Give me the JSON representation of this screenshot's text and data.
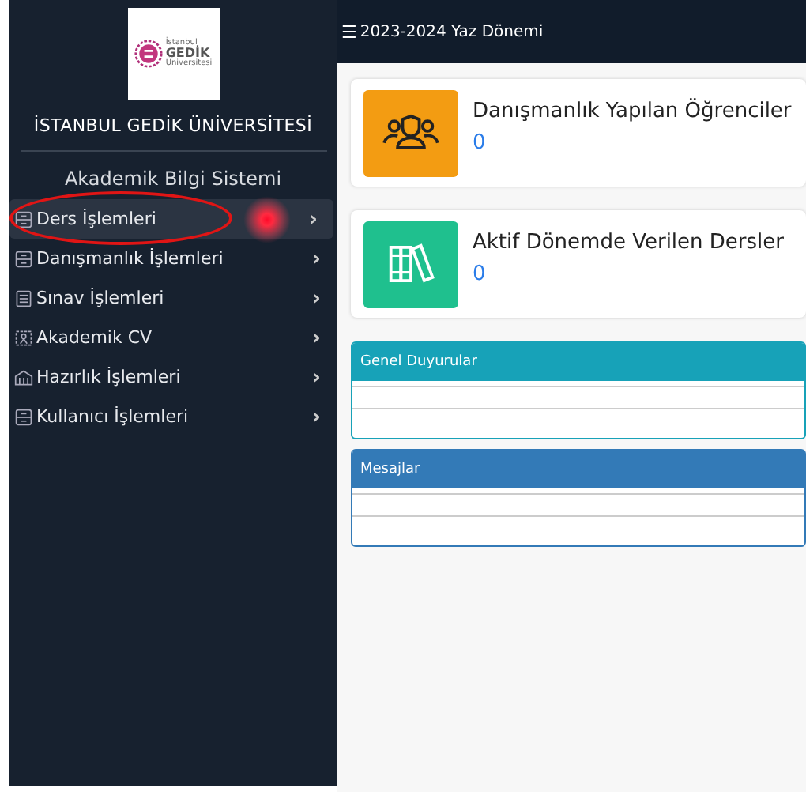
{
  "logo": {
    "small_top": "İstanbul",
    "name": "GEDİK",
    "small_bottom": "Üniversitesi"
  },
  "sidebar": {
    "university": "İSTANBUL GEDİK ÜNİVERSİTESİ",
    "system": "Akademik Bilgi Sistemi",
    "items": [
      {
        "label": "Ders İşlemleri",
        "kind": "form",
        "selected": true
      },
      {
        "label": "Danışmanlık İşlemleri",
        "kind": "form",
        "selected": false
      },
      {
        "label": "Sınav İşlemleri",
        "kind": "list",
        "selected": false
      },
      {
        "label": "Akademik CV",
        "kind": "person",
        "selected": false
      },
      {
        "label": "Hazırlık İşlemleri",
        "kind": "building",
        "selected": false
      },
      {
        "label": "Kullanıcı İşlemleri",
        "kind": "form",
        "selected": false
      }
    ],
    "chevron": "›"
  },
  "topbar": {
    "menu": "☰",
    "term": "2023-2024 Yaz Dönemi"
  },
  "cards": [
    {
      "title": "Danışmanlık Yapılan Öğrenciler",
      "count": "0",
      "kind": "people",
      "color": "#f39c12"
    },
    {
      "title": "Aktif Dönemde Verilen Dersler",
      "count": "0",
      "kind": "books",
      "color": "#1fc08e"
    }
  ],
  "panels": [
    {
      "title": "Genel Duyurular",
      "color": "#17a2b8"
    },
    {
      "title": "Mesajlar",
      "color": "#337ab7"
    }
  ],
  "annotation": {
    "kind": "circle"
  }
}
